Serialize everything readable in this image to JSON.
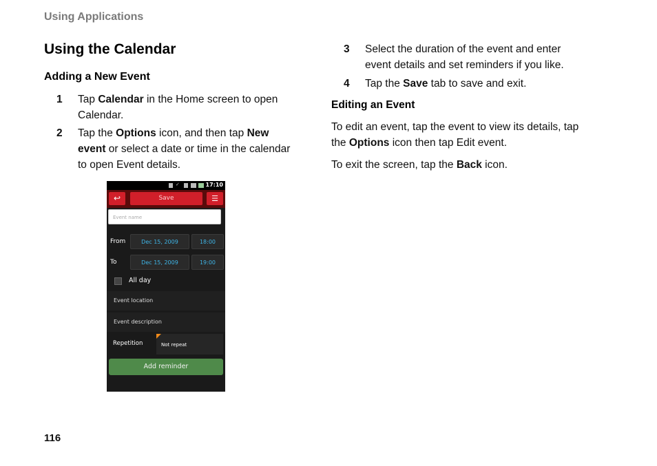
{
  "header": "Using Applications",
  "title": "Using the Calendar",
  "section1": {
    "heading": "Adding a New Event",
    "steps": [
      {
        "num": "1",
        "a": "Tap ",
        "b1": "Calendar",
        "c": " in the Home screen to open",
        "d": "Calendar."
      },
      {
        "num": "2",
        "a": "Tap the ",
        "b1": "Options",
        "c": " icon, and then tap ",
        "b2": "New",
        "b3": "event",
        "d": " or select a date or time in the calendar",
        "e": "to open Event details."
      },
      {
        "num": "3",
        "a": "Select the duration of the event and enter",
        "b": "event details and set reminders if you like."
      },
      {
        "num": "4",
        "a": "Tap the ",
        "b1": "Save",
        "c": " tab to save and exit."
      }
    ]
  },
  "section2": {
    "heading": "Editing an Event",
    "p1a": "To edit an event, tap the event to view its details, tap",
    "p1b_pre": "the ",
    "p1b_bold": "Options",
    "p1b_post": " icon then tap Edit event.",
    "p2_pre": "To exit the screen, tap the ",
    "p2_bold": "Back",
    "p2_post": " icon."
  },
  "page_number": "116",
  "phone": {
    "time": "17:10",
    "save_label": "Save",
    "event_name_placeholder": "Event name",
    "from_label": "From",
    "to_label": "To",
    "from_date": "Dec 15, 2009",
    "from_time": "18:00",
    "to_date": "Dec 15, 2009",
    "to_time": "19:00",
    "all_day": "All day",
    "event_location": "Event location",
    "event_description": "Event description",
    "repetition": "Repetition",
    "repetition_value": "Not repeat",
    "add_reminder": "Add reminder",
    "colors": {
      "accent_red": "#d11f2a",
      "field_text": "#3fb6e8",
      "button_green": "#4f8a4a"
    }
  }
}
